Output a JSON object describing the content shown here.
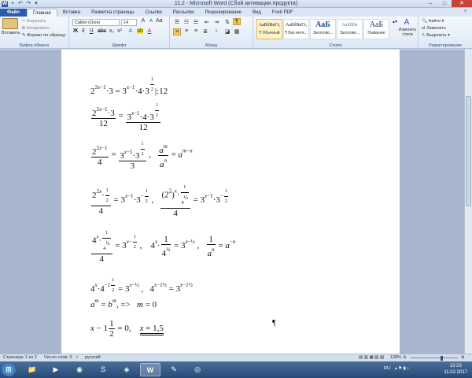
{
  "window": {
    "title": "11.2 - Microsoft Word (Сбой активации продукта)"
  },
  "qat_icons": [
    "word-icon",
    "save-icon",
    "undo-icon",
    "redo-icon",
    "customize-icon"
  ],
  "tabs": [
    "Файл",
    "Главная",
    "Вставка",
    "Разметка страницы",
    "Ссылки",
    "Рассылки",
    "Рецензирование",
    "Вид",
    "Foxit PDF"
  ],
  "ribbon": {
    "clipboard": {
      "paste": "Вставить",
      "cut": "Вырезать",
      "copy": "Копировать",
      "format_painter": "Формат по образцу",
      "label": "Буфер обмена"
    },
    "font": {
      "name": "Calibri (Осно",
      "size": "14",
      "label": "Шрифт"
    },
    "paragraph": {
      "label": "Абзац"
    },
    "styles": {
      "items": [
        {
          "sample": "АаБбВвГг,",
          "name": "¶ Обычный"
        },
        {
          "sample": "АаБбВвГг,",
          "name": "¶ Без инте..."
        },
        {
          "sample": "АаБ",
          "name": "Заголово..."
        },
        {
          "sample": "АаБбВв",
          "name": "Заголово..."
        },
        {
          "sample": "АаБ",
          "name": "Название"
        }
      ],
      "change": "Изменить стили",
      "label": "Стили"
    },
    "editing": {
      "find": "Найти",
      "replace": "Заменить",
      "select": "Выделить",
      "label": "Редактирование"
    }
  },
  "status": {
    "page": "Страница: 2 из 2",
    "words": "Число слов: 3",
    "lang": "русский",
    "zoom": "138%"
  },
  "taskbar": {
    "lang": "RU",
    "time": "13:23",
    "date": "11.02.2017"
  }
}
